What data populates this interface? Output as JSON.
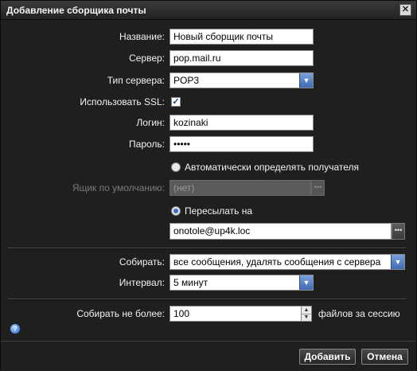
{
  "dialog": {
    "title": "Добавление сборщика почты",
    "close_glyph": "✕"
  },
  "form": {
    "name_label": "Название:",
    "name_value": "Новый сборщик почты",
    "server_label": "Сервер:",
    "server_value": "pop.mail.ru",
    "server_type_label": "Тип сервера:",
    "server_type_value": "POP3",
    "ssl_label": "Использовать SSL:",
    "ssl_checked": true,
    "login_label": "Логин:",
    "login_value": "kozinaki",
    "password_label": "Пароль:",
    "password_value": "•••••",
    "auto_detect_label": "Автоматически определять получателя",
    "auto_detect_selected": false,
    "default_box_label": "Ящик по умолчанию:",
    "default_box_value": "(нет)",
    "forward_label": "Пересылать на",
    "forward_selected": true,
    "forward_value": "onotole@up4k.loc",
    "collect_label": "Собирать:",
    "collect_value": "все сообщения, удалять сообщения с сервера",
    "interval_label": "Интервал:",
    "interval_value": "5 минут",
    "max_label": "Собирать не более:",
    "max_value": "100",
    "max_suffix": "файлов за сессию"
  },
  "buttons": {
    "add_label": "Добавить",
    "cancel_label": "Отмена"
  },
  "icons": {
    "help": "help-icon",
    "dropdown": "chevron-down-icon",
    "browse": "ellipsis-icon",
    "close": "close-icon"
  },
  "colors": {
    "background": "#1f1f1f",
    "accent": "#3d6bb5",
    "text": "#f0f0f0"
  }
}
